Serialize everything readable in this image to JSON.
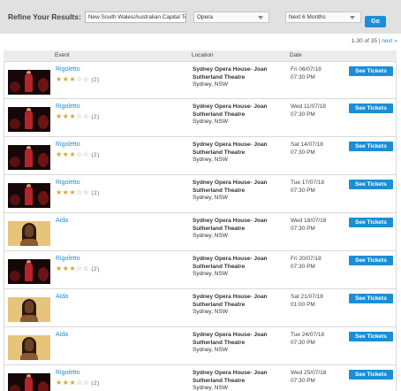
{
  "filters": {
    "label": "Refine Your Results:",
    "location_value": "New South Wales/Australian Capital Ter",
    "genre_value": "Opera",
    "period_value": "Next 6 Months",
    "go_label": "Go"
  },
  "pager": {
    "range": "1-30 of 35",
    "separator": "|",
    "next_label": "next »"
  },
  "columns": {
    "event": "Event",
    "location": "Location",
    "date": "Date"
  },
  "rows": [
    {
      "event": "Rigoletto",
      "rating": 3,
      "rating_max": 5,
      "review_count": "(2)",
      "image": "rigoletto",
      "venue_line1": "Sydney Opera House- Joan",
      "venue_line2": "Sutherland Theatre",
      "venue_city": "Sydney, NSW",
      "date": "Fri 06/07/18",
      "time": "07:30 PM",
      "button": "See Tickets"
    },
    {
      "event": "Rigoletto",
      "rating": 3,
      "rating_max": 5,
      "review_count": "(2)",
      "image": "rigoletto",
      "venue_line1": "Sydney Opera House- Joan",
      "venue_line2": "Sutherland Theatre",
      "venue_city": "Sydney, NSW",
      "date": "Wed 11/07/18",
      "time": "07:30 PM",
      "button": "See Tickets"
    },
    {
      "event": "Rigoletto",
      "rating": 3,
      "rating_max": 5,
      "review_count": "(2)",
      "image": "rigoletto",
      "venue_line1": "Sydney Opera House- Joan",
      "venue_line2": "Sutherland Theatre",
      "venue_city": "Sydney, NSW",
      "date": "Sat 14/07/18",
      "time": "07:30 PM",
      "button": "See Tickets"
    },
    {
      "event": "Rigoletto",
      "rating": 3,
      "rating_max": 5,
      "review_count": "(2)",
      "image": "rigoletto",
      "venue_line1": "Sydney Opera House- Joan",
      "venue_line2": "Sutherland Theatre",
      "venue_city": "Sydney, NSW",
      "date": "Tue 17/07/18",
      "time": "07:30 PM",
      "button": "See Tickets"
    },
    {
      "event": "Aida",
      "rating": 0,
      "rating_max": 0,
      "review_count": "",
      "image": "aida",
      "venue_line1": "Sydney Opera House- Joan",
      "venue_line2": "Sutherland Theatre",
      "venue_city": "Sydney, NSW",
      "date": "Wed 18/07/18",
      "time": "07:30 PM",
      "button": "See Tickets"
    },
    {
      "event": "Rigoletto",
      "rating": 3,
      "rating_max": 5,
      "review_count": "(2)",
      "image": "rigoletto",
      "venue_line1": "Sydney Opera House- Joan",
      "venue_line2": "Sutherland Theatre",
      "venue_city": "Sydney, NSW",
      "date": "Fri 20/07/18",
      "time": "07:30 PM",
      "button": "See Tickets"
    },
    {
      "event": "Aida",
      "rating": 0,
      "rating_max": 0,
      "review_count": "",
      "image": "aida",
      "venue_line1": "Sydney Opera House- Joan",
      "venue_line2": "Sutherland Theatre",
      "venue_city": "Sydney, NSW",
      "date": "Sat 21/07/18",
      "time": "01:00 PM",
      "button": "See Tickets"
    },
    {
      "event": "Aida",
      "rating": 0,
      "rating_max": 0,
      "review_count": "",
      "image": "aida",
      "venue_line1": "Sydney Opera House- Joan",
      "venue_line2": "Sutherland Theatre",
      "venue_city": "Sydney, NSW",
      "date": "Tue 24/07/18",
      "time": "07:30 PM",
      "button": "See Tickets"
    },
    {
      "event": "Rigoletto",
      "rating": 3,
      "rating_max": 5,
      "review_count": "(2)",
      "image": "rigoletto",
      "venue_line1": "Sydney Opera House- Joan",
      "venue_line2": "Sutherland Theatre",
      "venue_city": "Sydney, NSW",
      "date": "Wed 25/07/18",
      "time": "07:30 PM",
      "button": "See Tickets"
    }
  ],
  "colors": {
    "accent": "#1a8fd6",
    "star_on": "#d9a52b",
    "star_off": "#9a9a9a",
    "filter_bar": "#e1e1e1"
  }
}
